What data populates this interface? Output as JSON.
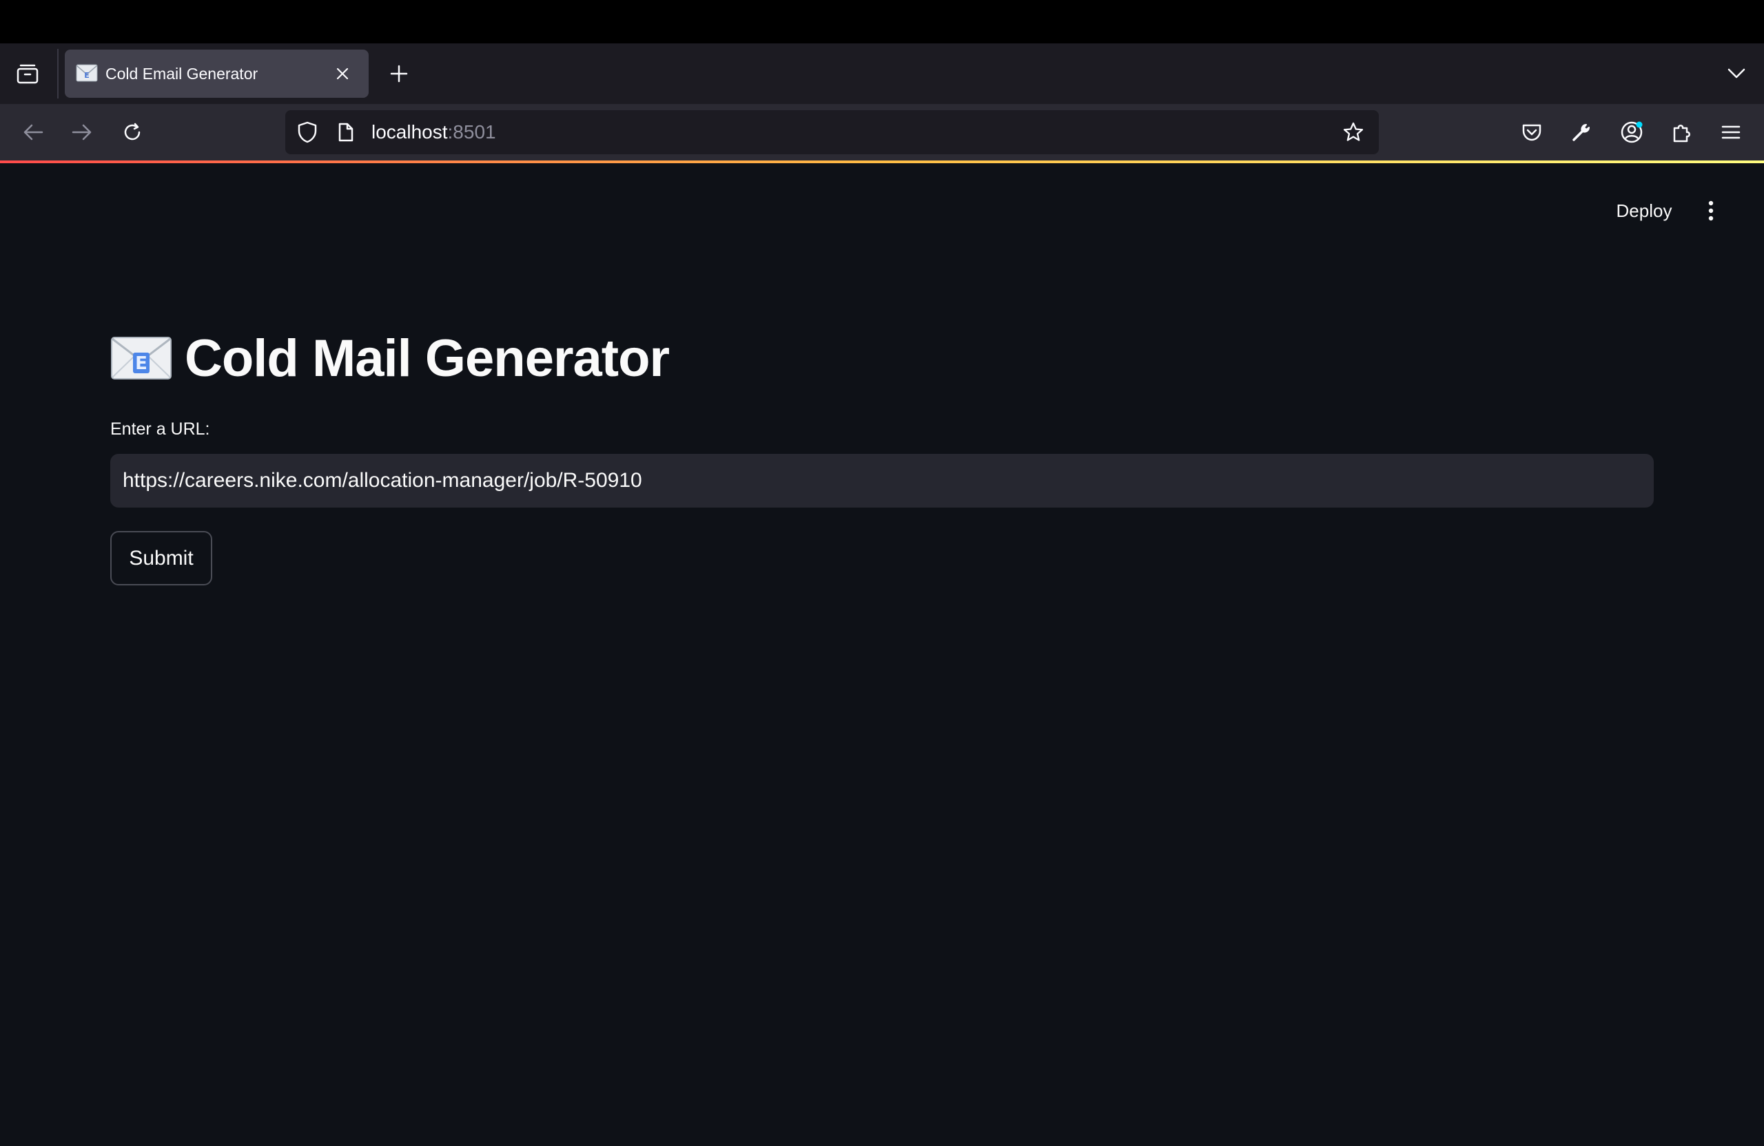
{
  "browser": {
    "tab": {
      "title": "Cold Email Generator"
    },
    "address": {
      "host": "localhost",
      "port": ":8501"
    }
  },
  "app": {
    "toolbar": {
      "deploy_label": "Deploy"
    },
    "title": "Cold Mail Generator",
    "url_field": {
      "label": "Enter a URL:",
      "value": "https://careers.nike.com/allocation-manager/job/R-50910"
    },
    "submit_label": "Submit"
  }
}
